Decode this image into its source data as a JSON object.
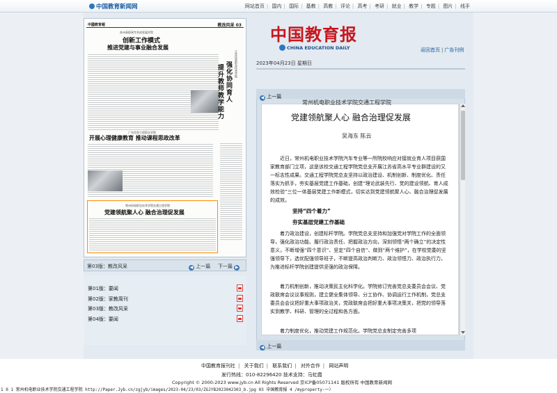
{
  "topbar": {
    "site_name": "中国教育新闻网",
    "nav": [
      "网站首页",
      "国内",
      "国际",
      "基教",
      "高教",
      "评论",
      "高考",
      "考研",
      "就业",
      "教学",
      "专题",
      "图片",
      "线手"
    ]
  },
  "masthead": {
    "title": "中国教育报",
    "english": "CHINA EDUCATION DAILY",
    "link_home": "返回首页",
    "link_ads": "广告刊例",
    "link_sep": "|"
  },
  "date": "2023年04月23日  星期日",
  "paper_thumb": {
    "header_left": "中國教育報",
    "header_right": "教改风采 03",
    "kicker1": "苏州高职高专合成发展学院",
    "title1": "创新工作模式",
    "title1b": "推进党建与事业融合发展",
    "kicker2": "广东信息工程职业学院",
    "title2": "开展心理健康教育  推动课程思政改革",
    "vert_kicker": "江苏信息职业技术学院",
    "vert_title1": "强化协同育人",
    "vert_title2": "提升教师教学能力",
    "kicker3": "常州机电职业技术学院交通工程学院",
    "title3": "党建领航聚人心  融合治理促发展"
  },
  "pagebar": {
    "current": "第03版：教改风采",
    "prev": "上一篇",
    "next": "下一篇"
  },
  "page_list": [
    "第01版：要闻",
    "第02版：家教周刊",
    "第03版：教改风采",
    "第04版：要闻"
  ],
  "article": {
    "prev_label": "上一篇",
    "kicker": "常州机电职业技术学院交通工程学院",
    "title": "党建领航聚人心  融合治理促发展",
    "author": "吴海东  陈云",
    "para1": "近日，常州机电职业技术学院汽车专业等一所院校响应对接就业育人项目获国家教育部门立项，这是该校交通工程学院党总支开展江苏省高水平专业群建设的又一标志性成果。交通工程学院党总支坚持以政治建设、机制创新、制度优化、责任落实为抓手，夯实基层党建工作基础，创建“理论武装先行、党的建设领航、育人成效检验”三位一体基层党建工作新模式，切实达到党建领航聚人心、融合治理促发展的成效。",
    "sub1": "坚持“四个着力”",
    "sub2": "夯实基层党建工作基础",
    "para2": "着力政治建设，创建标杆学院。学院党总支坚持和加强党对学院工作的全面领导，强化政治功能、履行政治责任、把握政治方向，深刻领悟“两个确立”的决定性意义，不断增强“四个意识”、坚定“四个自信”、做到“两个维护”，在学校党委的坚强领导下，选优配强领导班子，不断提高政治判断力、政治领悟力、政治执行力，为推进标杆学院创建提供坚强的政治保障。",
    "para3": "着力机制创新，推动决策民主化科学化。学院修订完善党总支委员会会议、党政联席会议议事规则，建立健全集体领导、分工协作、协调运行工作机制，党总支委员会会议把好重大事项政治关，党政联席会把好重大事项决策关，把党的领导落实到教学、科研、管理的全过程和各方面。",
    "para4": "着力制度优化，推动党建工作规范化。学院党总支制定完善多项",
    "bottom_prev": "上一篇"
  },
  "footer": {
    "links": [
      "中国教育报刊社",
      "关于我们",
      "联系我们",
      "对外合作",
      "网站声明"
    ],
    "contact": "发行热线：010-82296420  技术支持：马虹霞",
    "copyright": "Copyright © 2000-2023 www.jyb.cn All Rights Reserved 京ICP备05071141  版权所有 中国教育新闻网"
  },
  "statusbar": "1 0 1  常州机电职业技术学院交通工程学院  http://Paper.Jyb.cn/zgjyb/images/2023-04/23/03/ZGJYB2023042303_b.jpg 03  中国教育报 4 /myproperty-一〉"
}
